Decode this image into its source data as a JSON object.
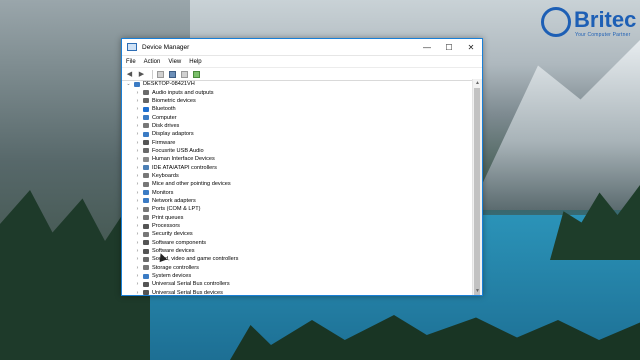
{
  "logo": {
    "name": "Britec",
    "tagline": "Your Computer Partner"
  },
  "window": {
    "title": "Device Manager",
    "controls": {
      "minimize": "—",
      "maximize": "☐",
      "close": "✕"
    }
  },
  "menu": [
    "File",
    "Action",
    "View",
    "Help"
  ],
  "toolbar": [
    "back-icon",
    "forward-icon",
    "properties-icon",
    "help-icon",
    "view-icon",
    "monitor-icon"
  ],
  "tree": {
    "root": "DESKTOP-08421VH",
    "items": [
      {
        "label": "Audio inputs and outputs",
        "icon": "speaker-icon",
        "color": "#6a6a6a"
      },
      {
        "label": "Biometric devices",
        "icon": "fingerprint-icon",
        "color": "#666666"
      },
      {
        "label": "Bluetooth",
        "icon": "bluetooth-icon",
        "color": "#1e6fd0"
      },
      {
        "label": "Computer",
        "icon": "computer-icon",
        "color": "#3b7bc4"
      },
      {
        "label": "Disk drives",
        "icon": "disk-icon",
        "color": "#777777"
      },
      {
        "label": "Display adaptors",
        "icon": "display-icon",
        "color": "#3b7bc4"
      },
      {
        "label": "Firmware",
        "icon": "chip-icon",
        "color": "#555555"
      },
      {
        "label": "Focusrite USB Audio",
        "icon": "speaker-icon",
        "color": "#6a6a6a"
      },
      {
        "label": "Human Interface Devices",
        "icon": "hid-icon",
        "color": "#8a8a8a"
      },
      {
        "label": "IDE ATA/ATAPI controllers",
        "icon": "controller-icon",
        "color": "#4c7fb5"
      },
      {
        "label": "Keyboards",
        "icon": "keyboard-icon",
        "color": "#777777"
      },
      {
        "label": "Mice and other pointing devices",
        "icon": "mouse-icon",
        "color": "#777777"
      },
      {
        "label": "Monitors",
        "icon": "monitor-icon",
        "color": "#3b7bc4"
      },
      {
        "label": "Network adapters",
        "icon": "network-icon",
        "color": "#3b7bc4"
      },
      {
        "label": "Ports (COM & LPT)",
        "icon": "port-icon",
        "color": "#777777"
      },
      {
        "label": "Print queues",
        "icon": "printer-icon",
        "color": "#777777"
      },
      {
        "label": "Processors",
        "icon": "processor-icon",
        "color": "#555555"
      },
      {
        "label": "Security devices",
        "icon": "security-icon",
        "color": "#777777"
      },
      {
        "label": "Software components",
        "icon": "software-component-icon",
        "color": "#555555"
      },
      {
        "label": "Software devices",
        "icon": "software-device-icon",
        "color": "#555555"
      },
      {
        "label": "Sound, video and game controllers",
        "icon": "speaker-icon",
        "color": "#6a6a6a"
      },
      {
        "label": "Storage controllers",
        "icon": "storage-icon",
        "color": "#777777"
      },
      {
        "label": "System devices",
        "icon": "system-icon",
        "color": "#3b7bc4"
      },
      {
        "label": "Universal Serial Bus controllers",
        "icon": "usb-icon",
        "color": "#555555"
      },
      {
        "label": "Universal Serial Bus devices",
        "icon": "usb-icon",
        "color": "#555555"
      }
    ]
  }
}
